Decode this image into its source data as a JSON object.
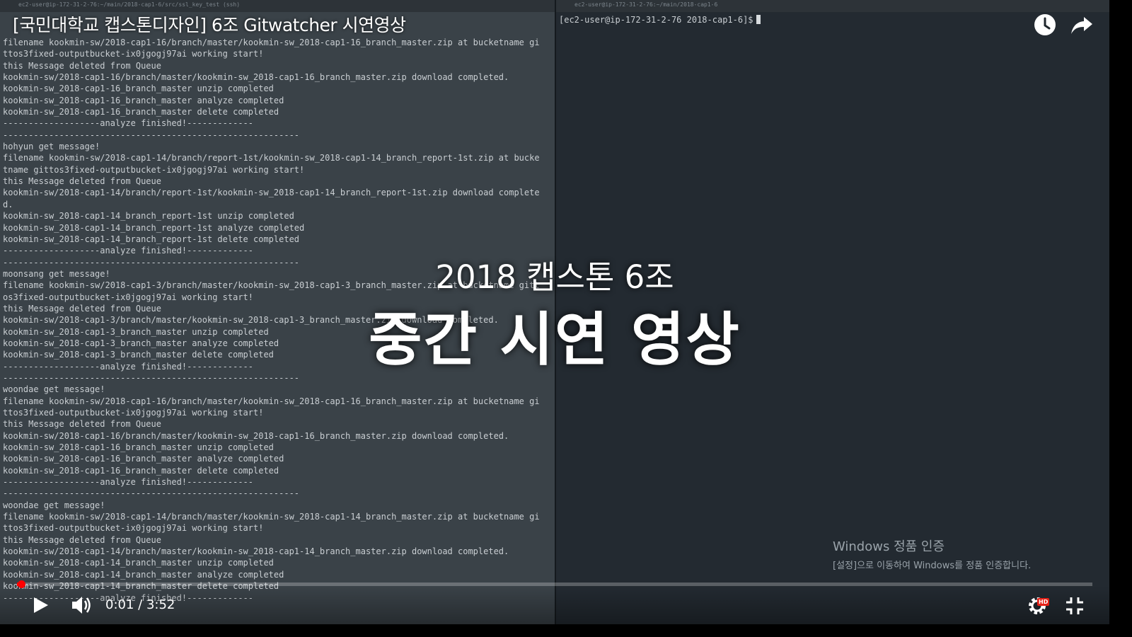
{
  "video": {
    "title": "[국민대학교 캡스톤디자인] 6조 Gitwatcher 시연영상",
    "overlay_subtitle": "2018 캡스톤 6조",
    "overlay_title": "중간 시연 영상",
    "current_time": "0:01",
    "separator": " / ",
    "duration": "3:52",
    "progress_fraction": 0.004,
    "accent_color": "#ff0000"
  },
  "terminal": {
    "left_tab": "ec2-user@ip-172-31-2-76:~/main/2018-cap1-6/src/ssl_key_test (ssh)",
    "right_tab": "ec2-user@ip-172-31-2-76:~/main/2018-cap1-6",
    "right_prompt": "[ec2-user@ip-172-31-2-76 2018-cap1-6]$",
    "left_lines": [
      "filename kookmin-sw/2018-cap1-16/branch/master/kookmin-sw_2018-cap1-16_branch_master.zip at bucketname gi",
      "ttos3fixed-outputbucket-ix0jgogj97ai working start!",
      "this Message deleted from Queue",
      "kookmin-sw/2018-cap1-16/branch/master/kookmin-sw_2018-cap1-16_branch_master.zip download completed.",
      "kookmin-sw_2018-cap1-16_branch_master unzip completed",
      "kookmin-sw_2018-cap1-16_branch_master analyze completed",
      "kookmin-sw_2018-cap1-16_branch_master delete completed",
      "-------------------analyze finished!-------------",
      "----------------------------------------------------------",
      "hohyun get message!",
      "filename kookmin-sw/2018-cap1-14/branch/report-1st/kookmin-sw_2018-cap1-14_branch_report-1st.zip at bucke",
      "tname gittos3fixed-outputbucket-ix0jgogj97ai working start!",
      "this Message deleted from Queue",
      "kookmin-sw/2018-cap1-14/branch/report-1st/kookmin-sw_2018-cap1-14_branch_report-1st.zip download complete",
      "d.",
      "kookmin-sw_2018-cap1-14_branch_report-1st unzip completed",
      "kookmin-sw_2018-cap1-14_branch_report-1st analyze completed",
      "kookmin-sw_2018-cap1-14_branch_report-1st delete completed",
      "-------------------analyze finished!-------------",
      "----------------------------------------------------------",
      "moonsang get message!",
      "filename kookmin-sw/2018-cap1-3/branch/master/kookmin-sw_2018-cap1-3_branch_master.zip at bucketname gitt",
      "os3fixed-outputbucket-ix0jgogj97ai working start!",
      "this Message deleted from Queue",
      "kookmin-sw/2018-cap1-3/branch/master/kookmin-sw_2018-cap1-3_branch_master.zip download completed.",
      "kookmin-sw_2018-cap1-3_branch_master unzip completed",
      "kookmin-sw_2018-cap1-3_branch_master analyze completed",
      "kookmin-sw_2018-cap1-3_branch_master delete completed",
      "-------------------analyze finished!-------------",
      "----------------------------------------------------------",
      "woondae get message!",
      "filename kookmin-sw/2018-cap1-16/branch/master/kookmin-sw_2018-cap1-16_branch_master.zip at bucketname gi",
      "ttos3fixed-outputbucket-ix0jgogj97ai working start!",
      "this Message deleted from Queue",
      "kookmin-sw/2018-cap1-16/branch/master/kookmin-sw_2018-cap1-16_branch_master.zip download completed.",
      "kookmin-sw_2018-cap1-16_branch_master unzip completed",
      "kookmin-sw_2018-cap1-16_branch_master analyze completed",
      "kookmin-sw_2018-cap1-16_branch_master delete completed",
      "-------------------analyze finished!-------------",
      "----------------------------------------------------------",
      "woondae get message!",
      "filename kookmin-sw/2018-cap1-14/branch/master/kookmin-sw_2018-cap1-14_branch_master.zip at bucketname gi",
      "ttos3fixed-outputbucket-ix0jgogj97ai working start!",
      "this Message deleted from Queue",
      "kookmin-sw/2018-cap1-14/branch/master/kookmin-sw_2018-cap1-14_branch_master.zip download completed.",
      "kookmin-sw_2018-cap1-14_branch_master unzip completed",
      "kookmin-sw_2018-cap1-14_branch_master analyze completed",
      "kookmin-sw_2018-cap1-14_branch_master delete completed",
      "-------------------analyze finished!-------------"
    ]
  },
  "watermark": {
    "line1": "Windows 정품 인증",
    "line2": "[설정]으로 이동하여 Windows를 정품 인증합니다."
  },
  "icons": {
    "watch_later": "clock-icon",
    "share": "share-arrow-icon",
    "play": "play-icon",
    "volume": "volume-icon",
    "settings": "gear-icon",
    "hd_badge": "HD",
    "exit_fullscreen": "exit-fullscreen-icon"
  }
}
